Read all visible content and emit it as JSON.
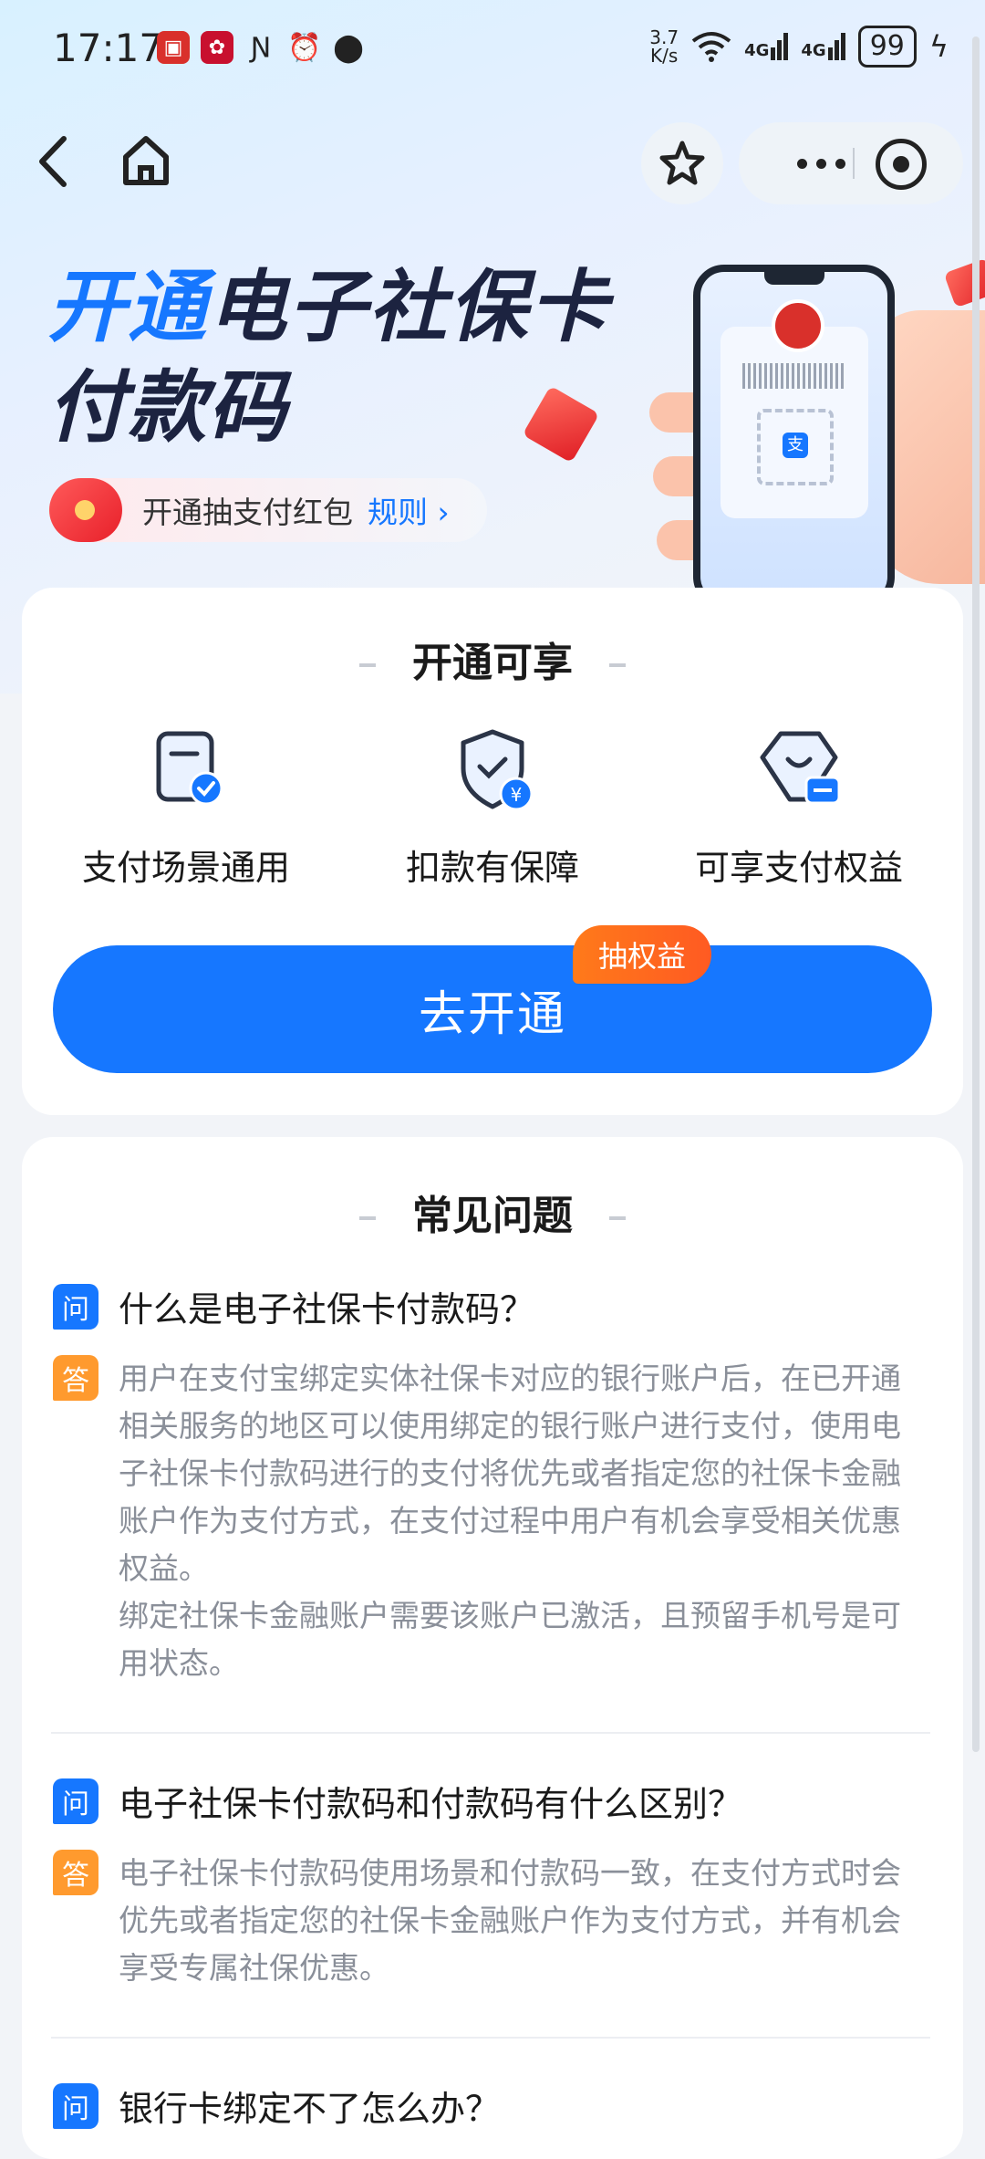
{
  "status_bar": {
    "time": "17:17",
    "net_speed_value": "3.7",
    "net_speed_unit": "K/s",
    "signal1": "4G",
    "signal2": "4G",
    "battery": "99"
  },
  "nav": {
    "back_icon": "back-arrow-icon",
    "home_icon": "home-icon",
    "star_icon": "star-icon",
    "more_icon": "more-icon",
    "close_icon": "close-miniapp-icon"
  },
  "hero": {
    "title_highlight": "开通",
    "title_rest": "电子社保卡",
    "title_line2": "付款码",
    "promo_text": "开通抽支付红包",
    "promo_rule": "规则 ›"
  },
  "benefits": {
    "title": "开通可享",
    "items": [
      {
        "label": "支付场景通用",
        "icon": "payment-scene-icon"
      },
      {
        "label": "扣款有保障",
        "icon": "shield-yuan-icon"
      },
      {
        "label": "可享支付权益",
        "icon": "coupon-tag-icon"
      }
    ],
    "cta_label": "去开通",
    "cta_badge": "抽权益"
  },
  "faq": {
    "title": "常见问题",
    "q_badge": "问",
    "a_badge": "答",
    "items": [
      {
        "question": "什么是电子社保卡付款码？",
        "answer": "用户在支付宝绑定实体社保卡对应的银行账户后，在已开通相关服务的地区可以使用绑定的银行账户进行支付，使用电子社保卡付款码进行的支付将优先或者指定您的社保卡金融账户作为支付方式，在支付过程中用户有机会享受相关优惠权益。",
        "answer2": "绑定社保卡金融账户需要该账户已激活，且预留手机号是可用状态。"
      },
      {
        "question": "电子社保卡付款码和付款码有什么区别？",
        "answer": "电子社保卡付款码使用场景和付款码一致，在支付方式时会优先或者指定您的社保卡金融账户作为支付方式，并有机会享受专属社保优惠。"
      },
      {
        "question": "银行卡绑定不了怎么办？"
      }
    ]
  }
}
